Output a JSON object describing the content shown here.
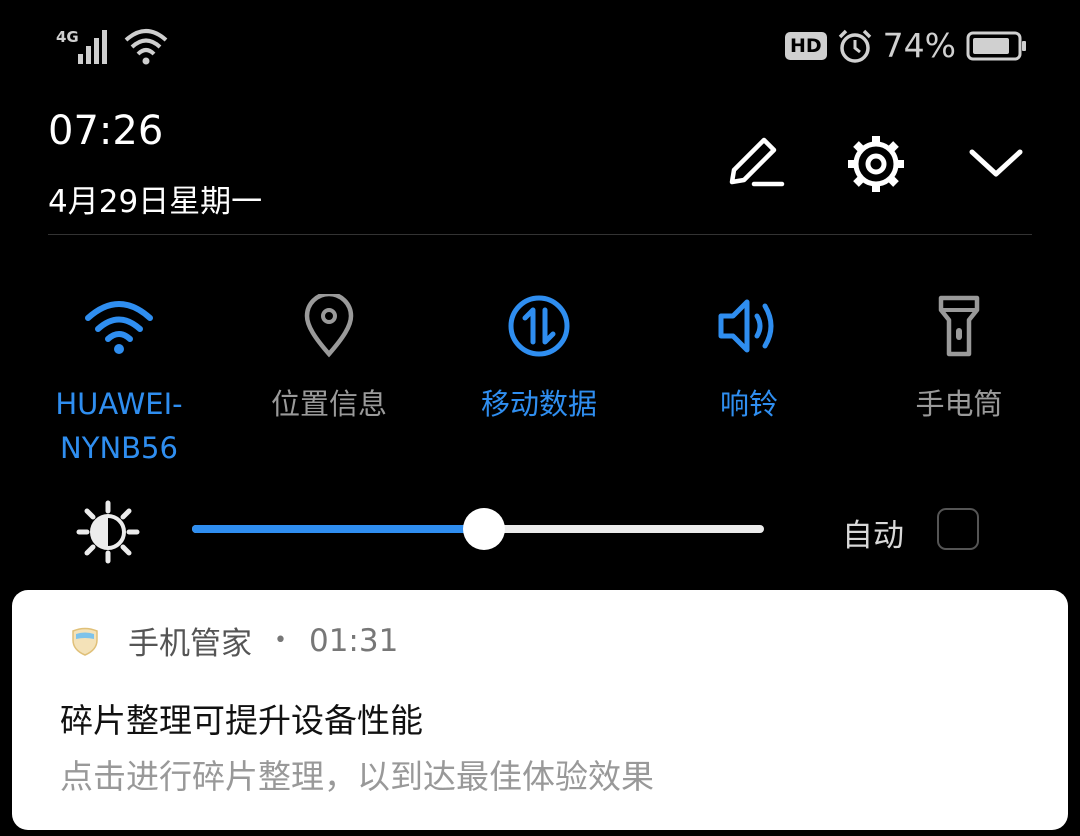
{
  "status_bar": {
    "network_type": "4G",
    "hd_badge": "HD",
    "battery_percent": "74%",
    "icons": [
      "signal-icon",
      "wifi-icon",
      "alarm-icon",
      "battery-icon"
    ]
  },
  "header": {
    "time": "07:26",
    "date": "4月29日星期一",
    "buttons": [
      "edit-icon",
      "settings-icon",
      "expand-icon"
    ]
  },
  "tiles": [
    {
      "name": "wifi",
      "label": "HUAWEI-\nNYNB56",
      "active": true,
      "icon": "wifi-icon"
    },
    {
      "name": "location",
      "label": "位置信息",
      "active": false,
      "icon": "location-pin-icon"
    },
    {
      "name": "mobile-data",
      "label": "移动数据",
      "active": true,
      "icon": "mobile-data-icon"
    },
    {
      "name": "sound",
      "label": "响铃",
      "active": true,
      "icon": "speaker-icon"
    },
    {
      "name": "flashlight",
      "label": "手电筒",
      "active": false,
      "icon": "flashlight-icon"
    }
  ],
  "brightness": {
    "level": 0.51,
    "auto_label": "自动",
    "auto_checked": false
  },
  "notification": {
    "app_name": "手机管家",
    "separator": "•",
    "time": "01:31",
    "title": "碎片整理可提升设备性能",
    "body": "点击进行碎片整理，以到达最佳体验效果"
  },
  "colors": {
    "accent": "#2f8ef0",
    "inactive": "#9a9a9a",
    "background": "#000000",
    "card": "#ffffff"
  }
}
